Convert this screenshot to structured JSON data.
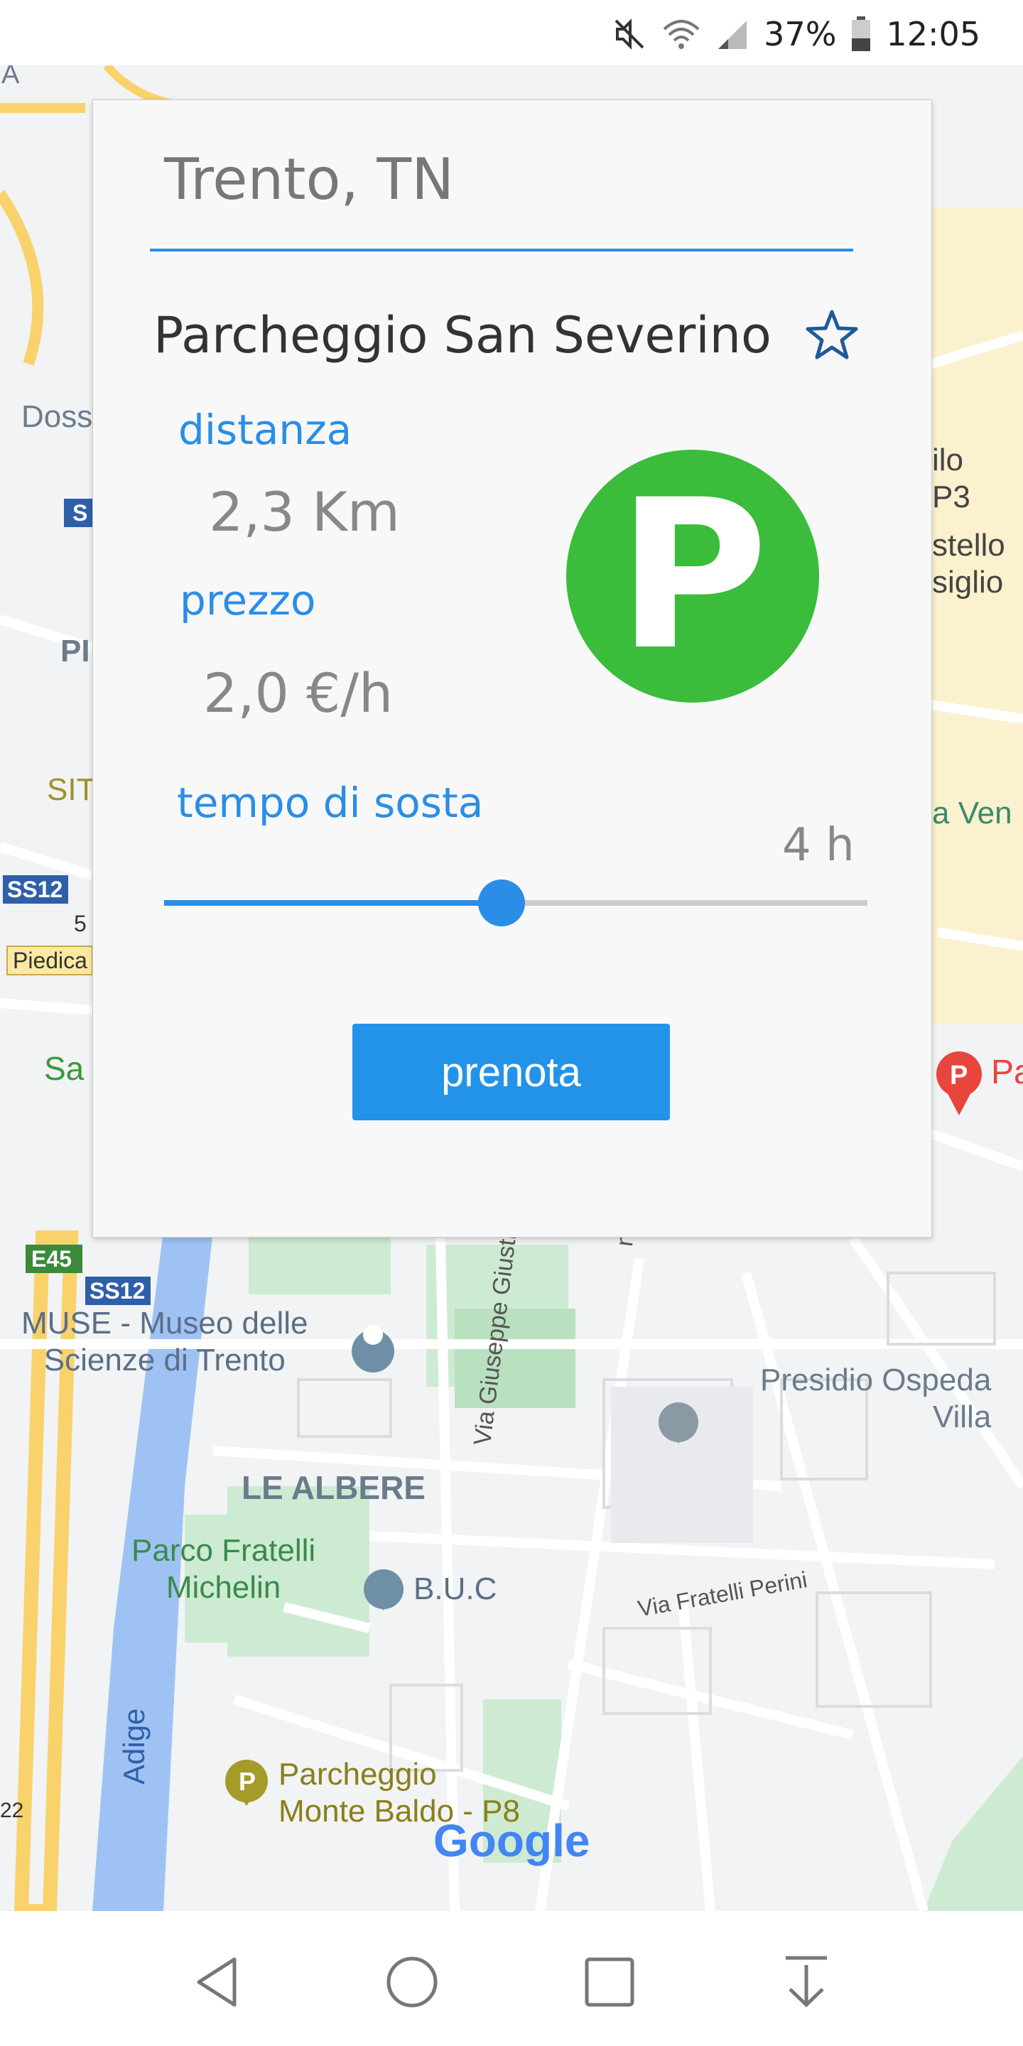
{
  "status_bar": {
    "battery": "37%",
    "time": "12:05"
  },
  "map": {
    "labels": {
      "muse": "MUSE - Museo delle\nScienze di Trento",
      "le_albere": "LE ALBERE",
      "parco": "Parco Fratelli\nMichelin",
      "buc": "B.U.C",
      "presidio": "Presidio Ospeda\nVilla",
      "via_giusti": "Via Giuseppe Giusti",
      "via_perini": "Via Fratelli Perini",
      "parcheggio": "Parcheggio\nMonte Baldo - P8",
      "adige": "Adige",
      "e45": "E45",
      "ss12a": "SS12",
      "ss12b": "SS12",
      "sfr_road": "S",
      "doss": "Doss",
      "pi": "PI",
      "sit": "SIT",
      "piedica": "Piedica",
      "five": "5",
      "san": "Sa",
      "twentytwo": "22",
      "ilo": "ilo\nP3",
      "stello": "stello\nsiglio",
      "vene": "a Ven",
      "pa": "Pa",
      "ni": "ni",
      "google": "Google",
      "left_a": "A"
    }
  },
  "card": {
    "search_value": "Trento, TN",
    "place_name": "Parcheggio San Severino",
    "distance_label": "distanza",
    "distance_value": "2,3 Km",
    "price_label": "prezzo",
    "price_value": "2,0 €/h",
    "duration_label": "tempo di sosta",
    "duration_value": "4 h",
    "slider_level": 0.48,
    "badge_letter": "P",
    "book_button": "prenota"
  },
  "colors": {
    "accent": "#2a8ee6",
    "badge_green": "#3bbc3b",
    "button_blue": "#2393ea"
  },
  "icons": [
    "mute-icon",
    "wifi-icon",
    "signal-icon",
    "battery-icon",
    "star-icon",
    "back-icon",
    "home-icon",
    "recents-icon",
    "download-icon"
  ]
}
